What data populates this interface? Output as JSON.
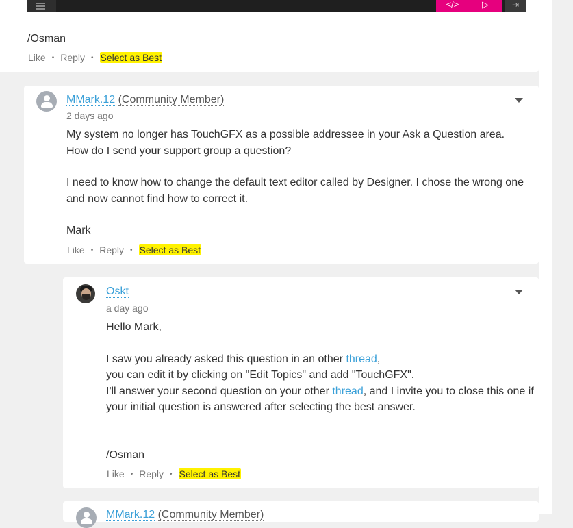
{
  "colors": {
    "link": "#3aa0d8",
    "highlight": "#fff200",
    "accent": "#e6007e",
    "text": "#333333",
    "muted": "#777777"
  },
  "top_post": {
    "toolbar": {
      "menu_icon": "menu-icon",
      "code_icon_glyph": "</>",
      "run_icon_glyph": "▷",
      "exit_icon_glyph": "⇥"
    },
    "signature": "/Osman",
    "actions": {
      "like": "Like",
      "reply": "Reply",
      "select_best": "Select as Best"
    }
  },
  "mark_comment": {
    "author": "MMark.12",
    "role": "(Community Member)",
    "time": "2 days ago",
    "lines": [
      "My system no longer has TouchGFX as a possible addressee in your Ask a Question area.",
      "How do I send your support group a question?",
      "I need to know how to change the default text editor called by Designer.  I chose the wrong one",
      "and now cannot find how to correct it.",
      "Mark"
    ],
    "actions": {
      "like": "Like",
      "reply": "Reply",
      "select_best": "Select as Best"
    }
  },
  "oskt_reply": {
    "author": "Oskt",
    "time": "a day ago",
    "greeting": "Hello Mark,",
    "p1_before": "I saw you already asked this question in an other ",
    "p1_link": "thread",
    "p1_after": ",",
    "p2": "you can edit it by clicking on \"Edit Topics\" and add \"TouchGFX\".",
    "p3_before": "I'll answer your second question on your other ",
    "p3_link": "thread",
    "p3_after": ", and I invite you to close this one if",
    "p4": "your initial question is answered after selecting the best answer.",
    "signature": "/Osman",
    "actions": {
      "like": "Like",
      "reply": "Reply",
      "select_best": "Select as Best"
    }
  },
  "next_comment": {
    "author": "MMark.12",
    "role": "(Community Member)"
  }
}
